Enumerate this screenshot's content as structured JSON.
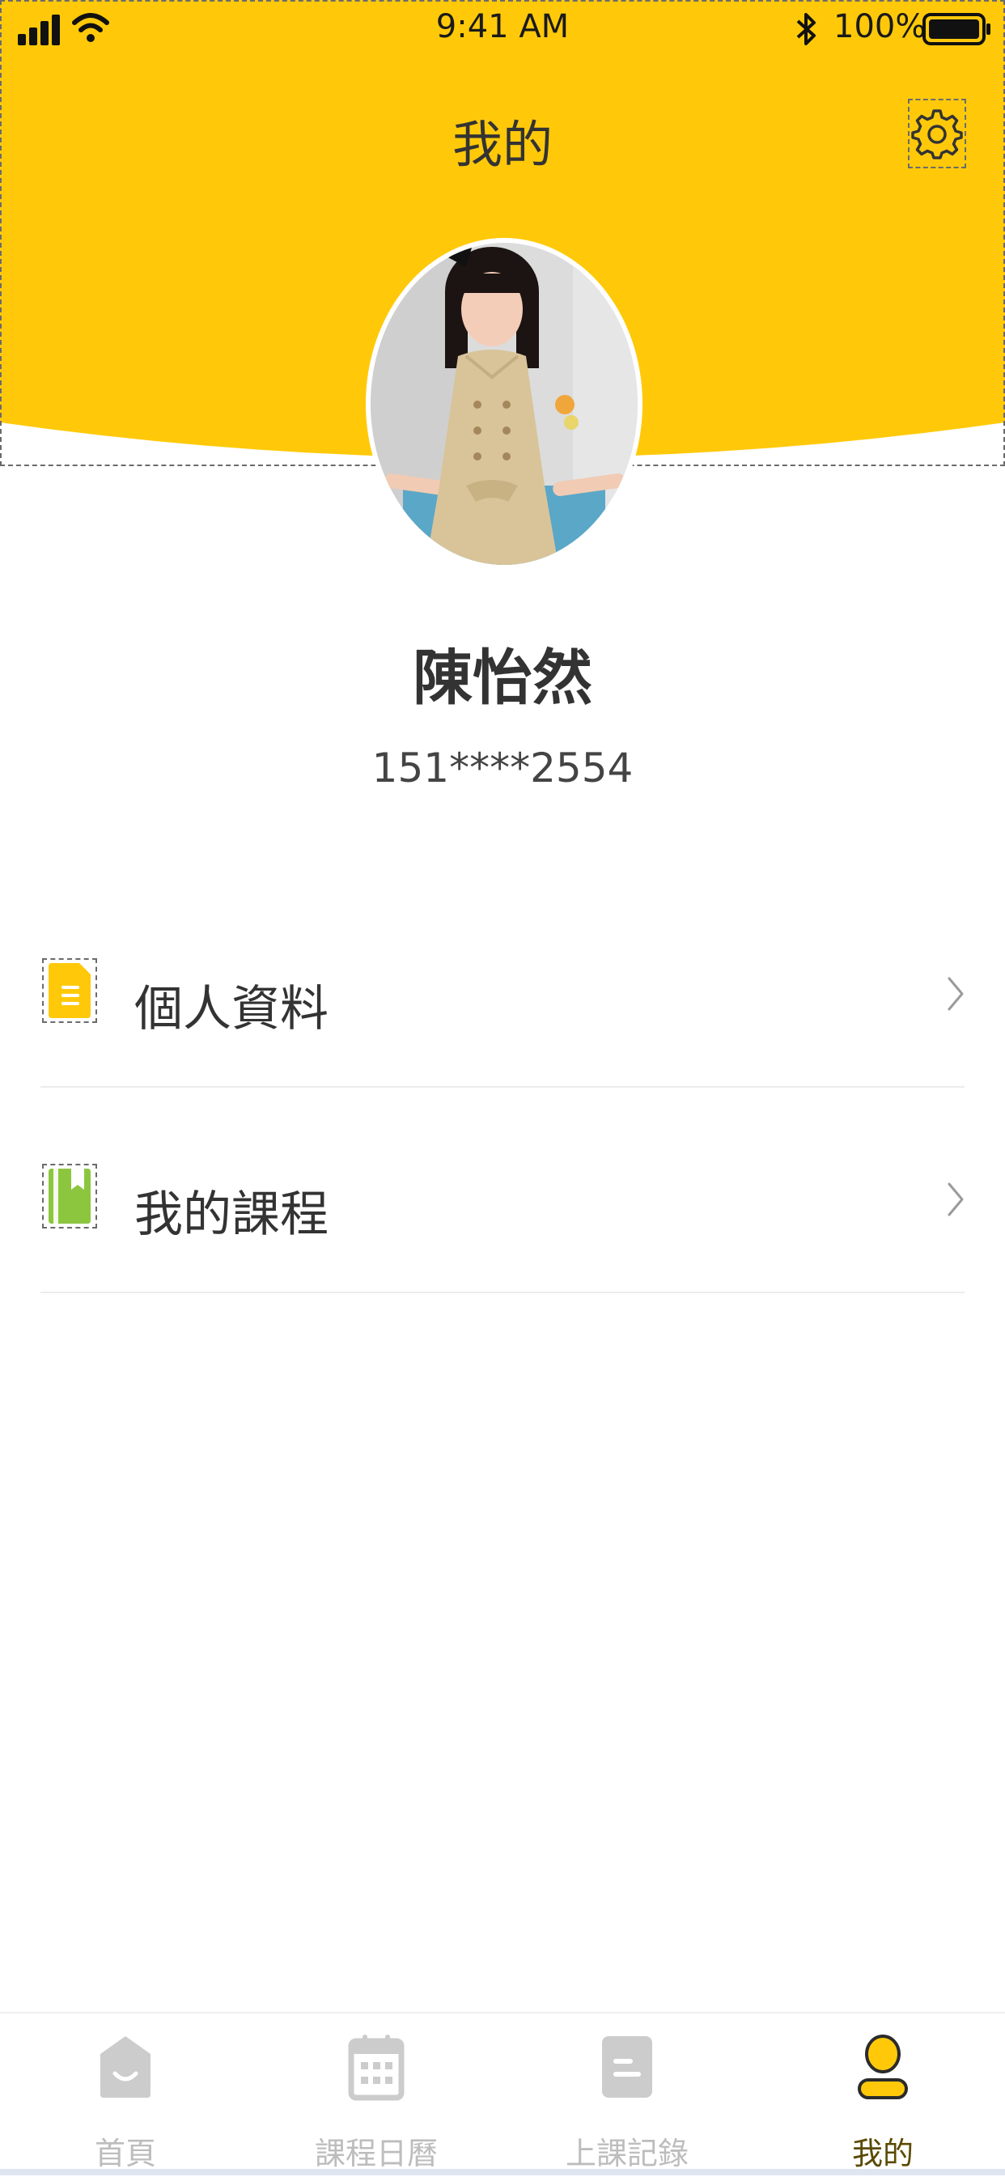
{
  "status_bar": {
    "time": "9:41 AM",
    "battery": "100%",
    "icons": [
      "signal-icon",
      "wifi-icon",
      "bluetooth-icon",
      "battery-icon"
    ]
  },
  "header": {
    "title": "我的",
    "settings_icon": "gear-icon",
    "background_color": "#FFC90A"
  },
  "profile": {
    "name": "陳怡然",
    "phone": "151****2554"
  },
  "menu": [
    {
      "label": "個人資料",
      "icon": "document-icon",
      "icon_color": "#FFC90A"
    },
    {
      "label": "我的課程",
      "icon": "book-icon",
      "icon_color": "#8CC63F"
    }
  ],
  "tabbar": {
    "tabs": [
      {
        "label": "首頁",
        "icon": "home-icon"
      },
      {
        "label": "課程日曆",
        "icon": "calendar-icon"
      },
      {
        "label": "上課記錄",
        "icon": "record-icon"
      },
      {
        "label": "我的",
        "icon": "user-icon"
      }
    ],
    "active_index": 3,
    "active_color": "#FFC90A",
    "active_text_color": "#5a4a00",
    "inactive_color": "#c8c8c8"
  }
}
